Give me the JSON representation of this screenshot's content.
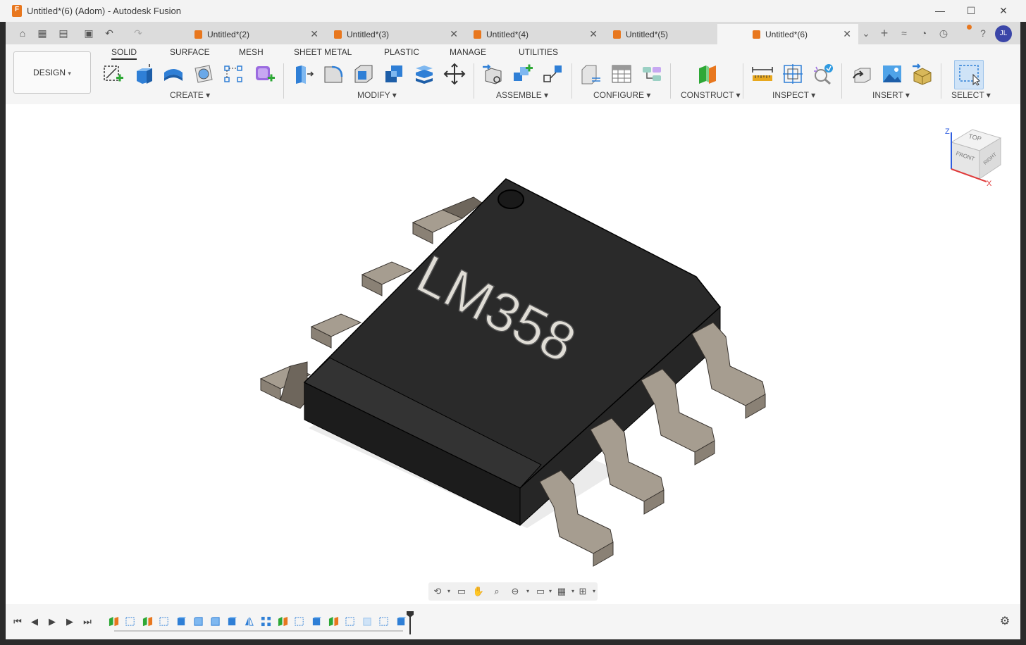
{
  "window": {
    "title": "Untitled*(6) (Adom) - Autodesk Fusion",
    "logo_letter": "F",
    "minimize": "—",
    "maximize": "☐",
    "close": "✕"
  },
  "quick_access": {
    "home": "⌂",
    "grid": "▦",
    "file": "▤",
    "save": "▣",
    "undo": "↶",
    "redo": "↷"
  },
  "doc_tabs": [
    {
      "label": "Untitled*(2)",
      "close": "✕"
    },
    {
      "label": "Untitled*(3)",
      "close": "✕"
    },
    {
      "label": "Untitled*(4)",
      "close": "✕"
    },
    {
      "label": "Untitled*(5)",
      "close": "✕"
    },
    {
      "label": "Untitled*(6)",
      "close": "✕"
    }
  ],
  "tabbar_right": {
    "more": "⌄",
    "new_tab": "+",
    "extensions": "≈",
    "job_status": "◔",
    "notifications": "◷",
    "help": "?",
    "avatar_initials": "JL"
  },
  "workspace": {
    "label": "DESIGN",
    "arrow": "▾"
  },
  "ribbon_tabs": [
    "SOLID",
    "SURFACE",
    "MESH",
    "SHEET METAL",
    "PLASTIC",
    "MANAGE",
    "UTILITIES"
  ],
  "ribbon_groups": [
    {
      "label": "CREATE ▾"
    },
    {
      "label": "MODIFY ▾"
    },
    {
      "label": "ASSEMBLE ▾"
    },
    {
      "label": "CONFIGURE ▾"
    },
    {
      "label": "CONSTRUCT ▾"
    },
    {
      "label": "INSPECT ▾"
    },
    {
      "label": "INSERT ▾"
    },
    {
      "label": "SELECT ▾"
    }
  ],
  "viewcube": {
    "top": "TOP",
    "front": "FRONT",
    "right": "RIGHT",
    "axis_z": "Z",
    "axis_x": "X"
  },
  "model": {
    "chip_marking": "LM358"
  },
  "nav_bar": {
    "orbit": "⟲",
    "look": "▭",
    "pan": "✋",
    "zoom": "⌕",
    "fit": "⊖",
    "display": "▭",
    "grid": "▦",
    "viewports": "⊞",
    "caret": "▾"
  },
  "timeline": {
    "first": "⏮",
    "prev": "◀",
    "play": "▶",
    "next": "▶",
    "last": "⏭",
    "settings": "⚙"
  },
  "colors": {
    "accent_orange": "#e8771e",
    "avatar_blue": "#3b46a8",
    "chip_body": "#2a2a2a",
    "lead": "#8a8175"
  }
}
